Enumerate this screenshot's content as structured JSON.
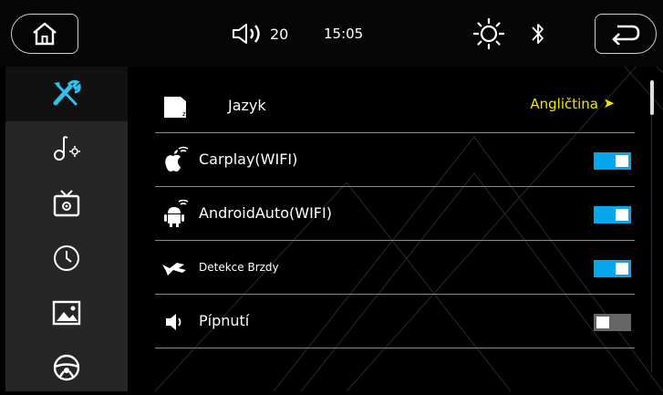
{
  "topbar": {
    "volume": "20",
    "time": "15:05"
  },
  "sidebar": {
    "items": [
      {
        "icon": "settings-tools-icon",
        "active": true
      },
      {
        "icon": "music-settings-icon",
        "active": false
      },
      {
        "icon": "tv-settings-icon",
        "active": false
      },
      {
        "icon": "clock-icon",
        "active": false
      },
      {
        "icon": "image-icon",
        "active": false
      },
      {
        "icon": "steering-wheel-icon",
        "active": false
      }
    ]
  },
  "settings": {
    "language": {
      "label": "Jazyk",
      "value": "Angličtina",
      "arrow": "➤"
    },
    "carplay": {
      "label": "Carplay(WIFI)",
      "on": true
    },
    "androidauto": {
      "label": "AndroidAuto(WIFI)",
      "on": true
    },
    "brake": {
      "label": "Detekce Brzdy",
      "on": true
    },
    "beep": {
      "label": "Pípnutí",
      "on": false
    }
  },
  "colors": {
    "accent": "#05a6ec",
    "value_text": "#f2e600",
    "sidebar_bg": "#262626"
  }
}
